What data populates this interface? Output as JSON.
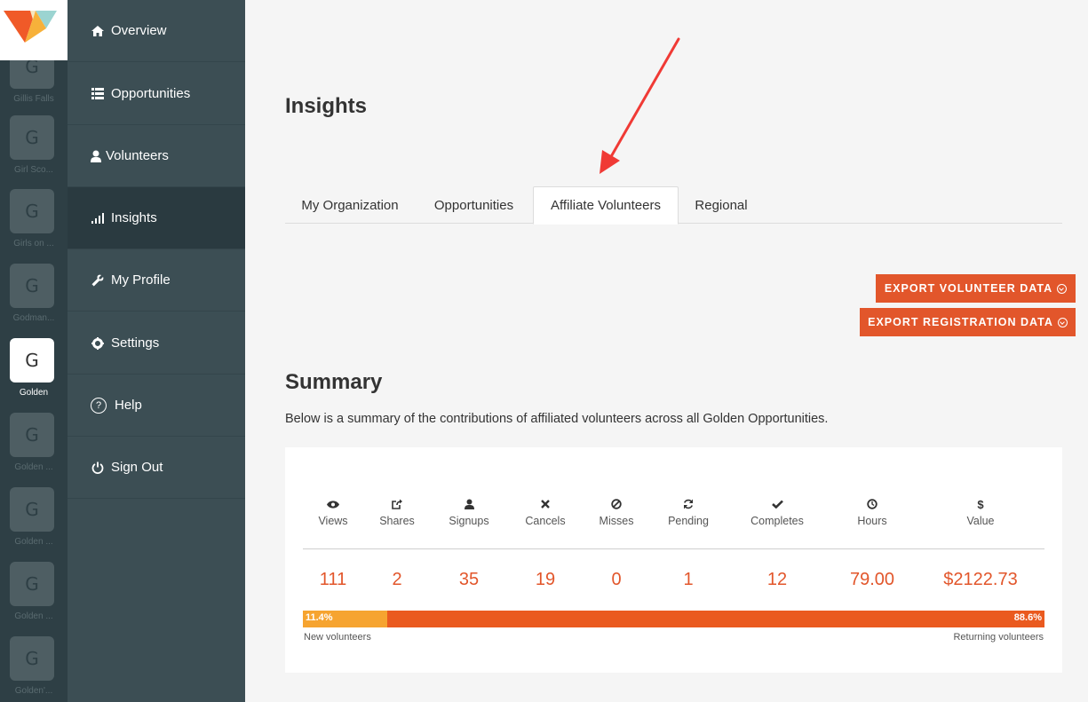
{
  "colors": {
    "accent": "#e2562b",
    "rail": "#2e3f45",
    "nav": "#3c4e54",
    "nav_active": "#2a3a40",
    "new_bar": "#f6a430",
    "returning_bar": "#ea5a1f"
  },
  "orgs": [
    {
      "initial": "G",
      "name": "Gillis Falls"
    },
    {
      "initial": "G",
      "name": "Girl Sco..."
    },
    {
      "initial": "G",
      "name": "Girls on ..."
    },
    {
      "initial": "G",
      "name": "Godman..."
    },
    {
      "initial": "G",
      "name": "Golden"
    },
    {
      "initial": "G",
      "name": "Golden ..."
    },
    {
      "initial": "G",
      "name": "Golden ..."
    },
    {
      "initial": "G",
      "name": "Golden ..."
    },
    {
      "initial": "G",
      "name": "Golden'..."
    }
  ],
  "nav": {
    "items": [
      {
        "label": "Overview",
        "icon": "home-icon"
      },
      {
        "label": "Opportunities",
        "icon": "list-icon"
      },
      {
        "label": "Volunteers",
        "icon": "user-icon"
      },
      {
        "label": "Insights",
        "icon": "signal-icon"
      },
      {
        "label": "My Profile",
        "icon": "wrench-icon"
      },
      {
        "label": "Settings",
        "icon": "gear-icon"
      },
      {
        "label": "Help",
        "icon": "help-icon"
      },
      {
        "label": "Sign Out",
        "icon": "power-icon"
      }
    ]
  },
  "page": {
    "title": "Insights"
  },
  "tabs": [
    {
      "label": "My Organization"
    },
    {
      "label": "Opportunities"
    },
    {
      "label": "Affiliate Volunteers"
    },
    {
      "label": "Regional"
    }
  ],
  "actions": {
    "export_volunteer": "EXPORT VOLUNTEER DATA",
    "export_registration": "EXPORT REGISTRATION DATA"
  },
  "summary": {
    "title": "Summary",
    "description": "Below is a summary of the contributions of affiliated volunteers across all Golden Opportunities.",
    "stats": [
      {
        "label": "Views",
        "value": "111",
        "icon": "eye-icon"
      },
      {
        "label": "Shares",
        "value": "2",
        "icon": "share-icon"
      },
      {
        "label": "Signups",
        "value": "35",
        "icon": "user-icon"
      },
      {
        "label": "Cancels",
        "value": "19",
        "icon": "x-icon"
      },
      {
        "label": "Misses",
        "value": "0",
        "icon": "ban-icon"
      },
      {
        "label": "Pending",
        "value": "1",
        "icon": "refresh-icon"
      },
      {
        "label": "Completes",
        "value": "12",
        "icon": "check-icon"
      },
      {
        "label": "Hours",
        "value": "79.00",
        "icon": "clock-icon"
      },
      {
        "label": "Value",
        "value": "$2122.73",
        "icon": "dollar-icon"
      }
    ],
    "split": {
      "new_pct": 11.4,
      "new_label": "11.4%",
      "returning_label": "88.6%",
      "new_legend": "New volunteers",
      "returning_legend": "Returning volunteers"
    }
  }
}
